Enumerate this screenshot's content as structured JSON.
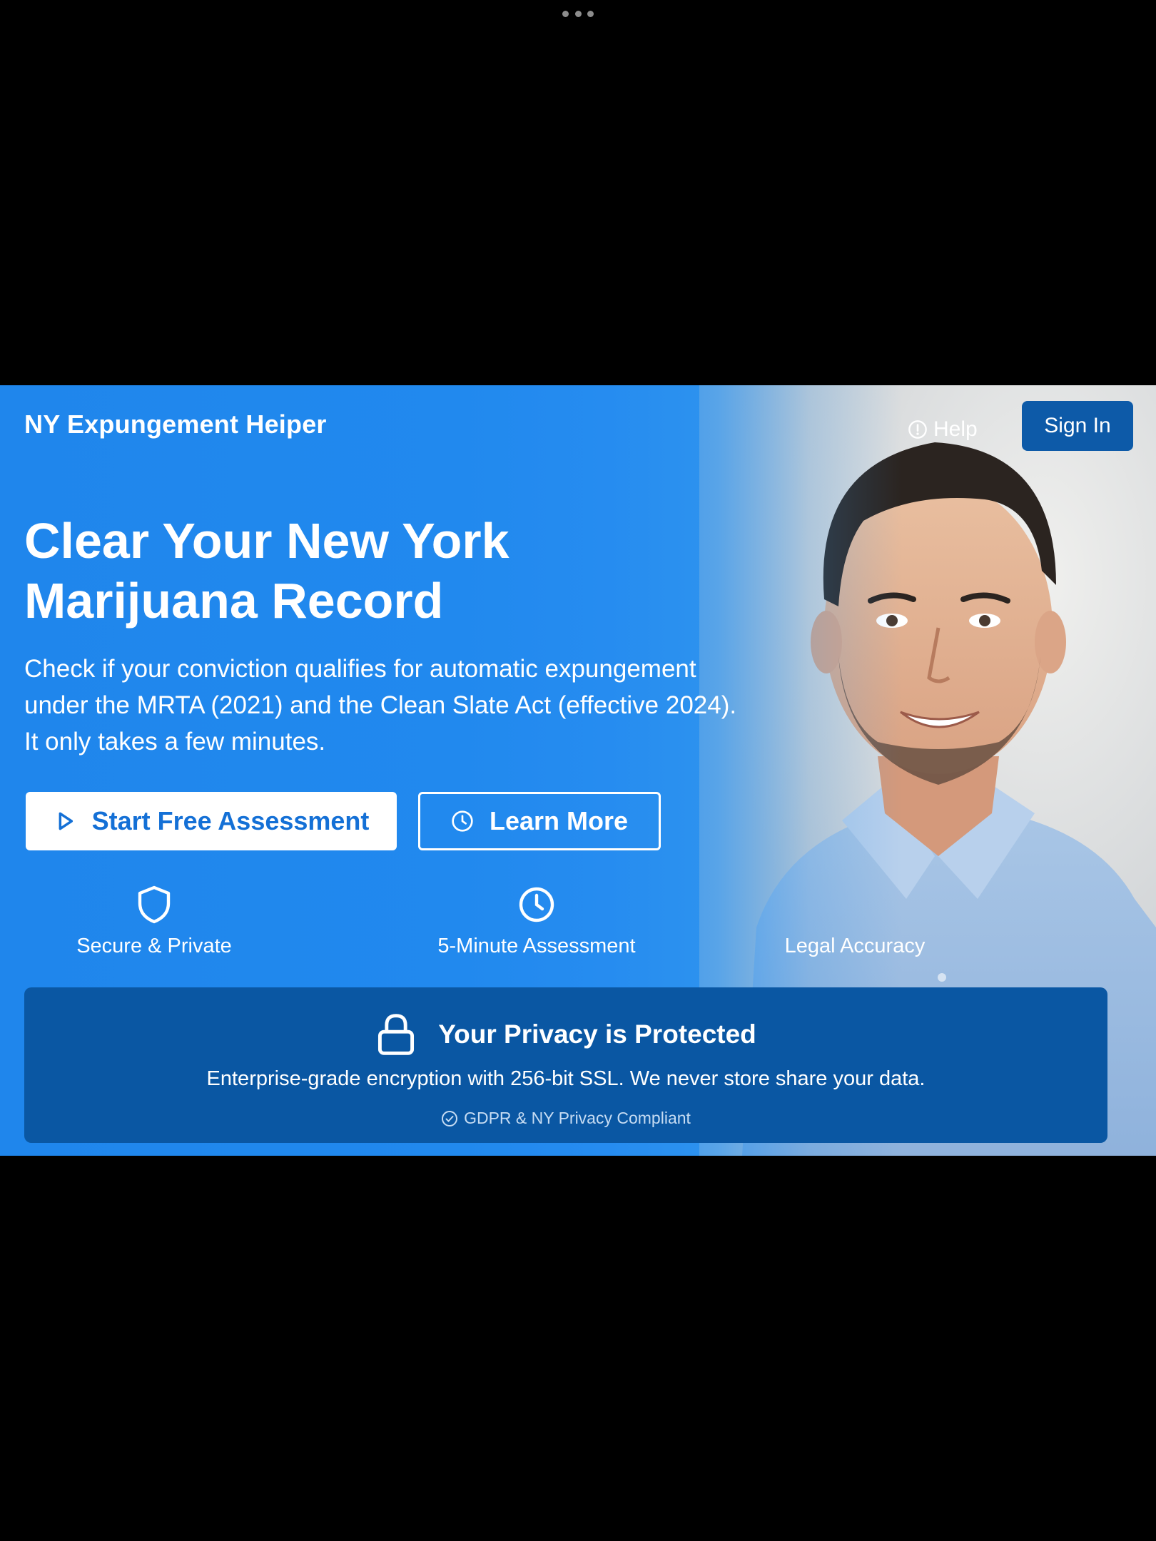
{
  "header": {
    "brand": "NY Expungement Heiper",
    "help_label": "Help",
    "signin_label": "Sign In"
  },
  "hero": {
    "headline_line1": "Clear Your New York",
    "headline_line2": "Marijuana Record",
    "subtext_line1": "Check if your conviction qualifies for automatic expungement",
    "subtext_line2": "under the MRTA (2021) and the Clean Slate Act (effective 2024).",
    "subtext_line3": "It only takes a few minutes."
  },
  "actions": {
    "start_label": "Start Free Assessment",
    "learn_label": "Learn More"
  },
  "features": [
    {
      "label": "Secure & Private",
      "icon": "shield-icon"
    },
    {
      "label": "5-Minute Assessment",
      "icon": "clock-icon"
    },
    {
      "label": "Legal Accuracy",
      "icon": "none"
    }
  ],
  "privacy": {
    "title": "Your Privacy is Protected",
    "text": "Enterprise-grade encryption with 256-bit SSL. We never store share your data.",
    "compliance": "GDPR & NY Privacy Compliant"
  },
  "colors": {
    "hero_blue": "#1e88ea",
    "signin_bg": "#0d5aa8",
    "privacy_bg": "#0a57a3",
    "button_text_blue": "#1470d6"
  }
}
